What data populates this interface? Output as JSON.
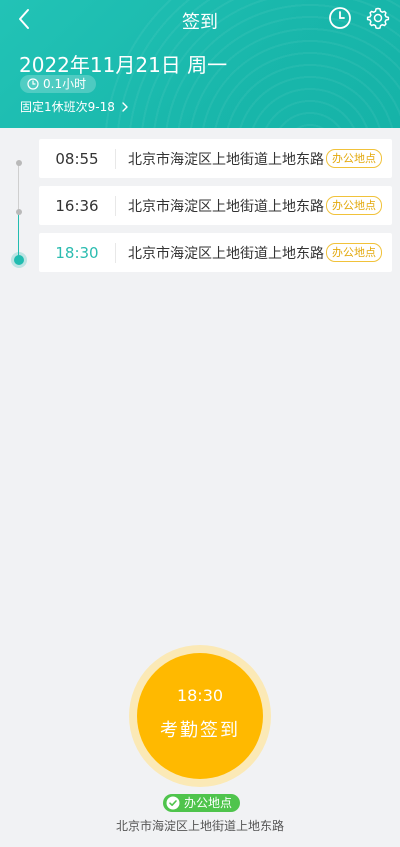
{
  "nav": {
    "title": "签到"
  },
  "header": {
    "date": "2022年11月21日 周一",
    "hours": "0.1小时",
    "shift": "固定1休班次9-18"
  },
  "records": [
    {
      "time": "08:55",
      "address": "北京市海淀区上地街道上地东路",
      "tag": "办公地点"
    },
    {
      "time": "16:36",
      "address": "北京市海淀区上地街道上地东路",
      "tag": "办公地点"
    },
    {
      "time": "18:30",
      "address": "北京市海淀区上地街道上地东路",
      "tag": "办公地点"
    }
  ],
  "checkin": {
    "time": "18:30",
    "label": "考勤签到",
    "location_badge": "办公地点",
    "location_text": "北京市海淀区上地街道上地东路"
  },
  "colors": {
    "header": "#1db9ad",
    "accent": "#22bcb0",
    "button": "#ffb900",
    "tag_border": "#f1c23a",
    "location_badge": "#4fc44c"
  },
  "icons": [
    "back-icon",
    "history-clock-icon",
    "settings-gear-icon",
    "clock-icon",
    "chevron-right-icon",
    "check-circle-icon"
  ]
}
